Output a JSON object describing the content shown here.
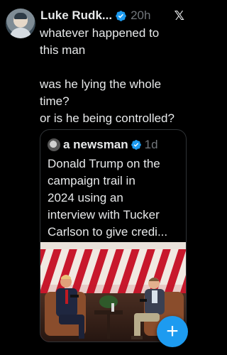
{
  "post": {
    "author_name": "Luke Rudk...",
    "timestamp": "20h",
    "text_lines": [
      "whatever happened to",
      "this man",
      "",
      "was he lying the whole",
      "time?",
      "or is he being controlled?"
    ]
  },
  "quoted_post": {
    "author_name": "a newsman",
    "timestamp": "1d",
    "text_lines": [
      "Donald Trump on the",
      "campaign trail in",
      "2024 using an",
      "interview with Tucker",
      "Carlson to give credi..."
    ]
  },
  "icons": {
    "verified": "verified-badge-icon",
    "platform": "x-logo-icon",
    "compose": "plus-icon"
  },
  "compose_button": {
    "label": "+"
  },
  "platform_logo_text": "𝕏",
  "colors": {
    "background": "#000000",
    "primary_text": "#e7e9ea",
    "secondary_text": "#71767b",
    "accent": "#1d9bf0",
    "border": "#2f3336"
  }
}
